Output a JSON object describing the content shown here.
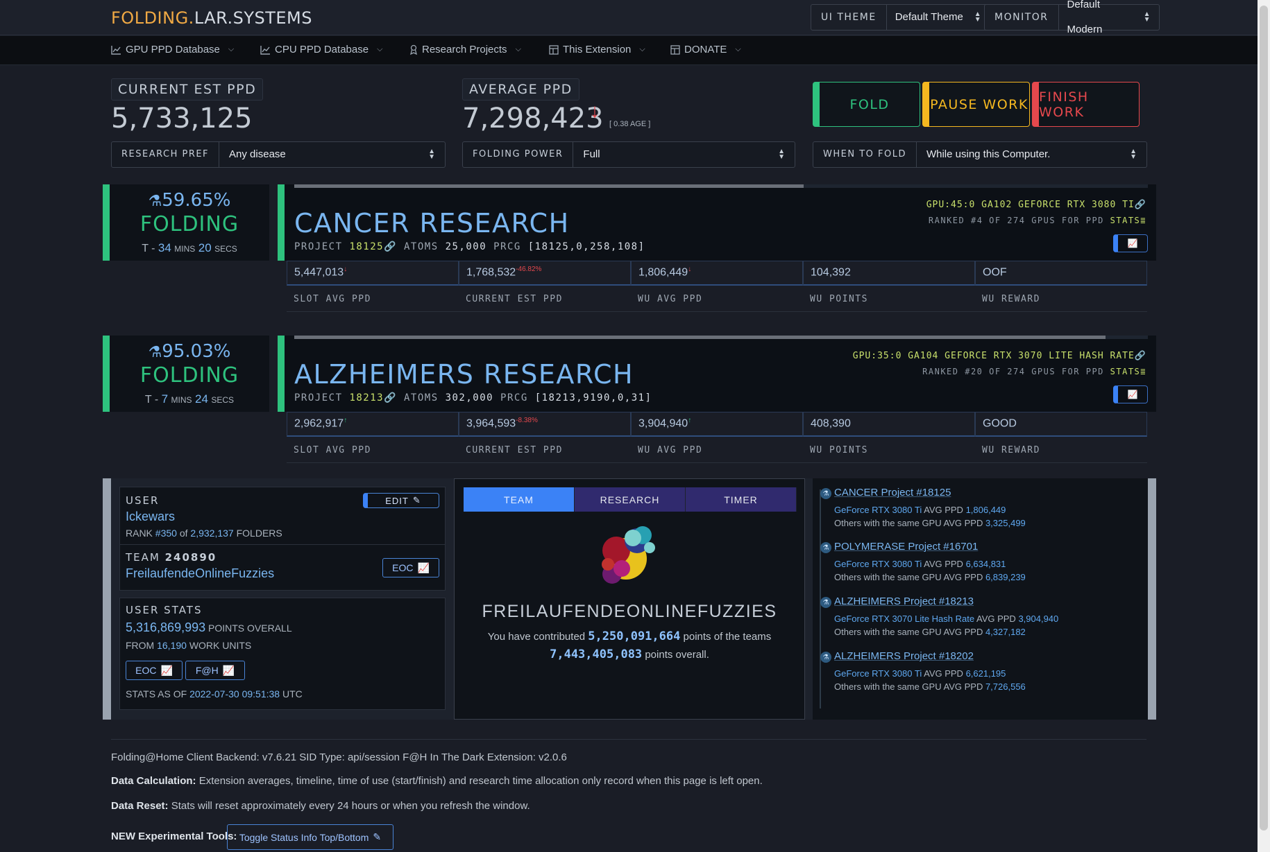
{
  "header": {
    "logo_part1": "FOLDING.",
    "logo_part2": "LAR.SYSTEMS",
    "ui_theme_label": "UI THEME",
    "ui_theme_value": "Default Theme",
    "monitor_label": "MONITOR",
    "monitor_value": "Default Modern"
  },
  "nav": {
    "items": [
      {
        "label": "GPU PPD Database",
        "icon": "chart-line-icon"
      },
      {
        "label": "CPU PPD Database",
        "icon": "chart-line-icon"
      },
      {
        "label": "Research Projects",
        "icon": "ribbon-icon"
      },
      {
        "label": "This Extension",
        "icon": "window-icon"
      },
      {
        "label": "DONATE",
        "icon": "window-icon"
      }
    ]
  },
  "stats": {
    "current_label": "CURRENT EST PPD",
    "current_value": "5,733,125",
    "average_label": "AVERAGE PPD",
    "average_value": "7,298,423",
    "average_age": "[ 0.38 AGE ]",
    "average_trend": "down"
  },
  "controls": {
    "fold": "FOLD",
    "pause": "PAUSE WORK",
    "finish": "FINISH WORK",
    "research_pref_label": "RESEARCH PREF",
    "research_pref_value": "Any disease",
    "folding_power_label": "FOLDING POWER",
    "folding_power_value": "Full",
    "when_label": "WHEN TO FOLD",
    "when_value": "While using this Computer."
  },
  "work_units": [
    {
      "percent": "59.65%",
      "progress": 0.5965,
      "state": "FOLDING",
      "eta_prefix": "T - ",
      "eta_mins": "34",
      "eta_mins_unit": "MINS",
      "eta_secs": "20",
      "eta_secs_unit": "SECS",
      "title": "CANCER RESEARCH",
      "project_label": "PROJECT",
      "project": "18125",
      "atoms_label": "ATOMS",
      "atoms": "25,000",
      "prcg_label": "PRCG",
      "prcg": "[18125,0,258,108]",
      "gpu": "GPU:45:0 GA102 GEFORCE RTX 3080 TI",
      "rank": "RANKED #4 OF 274 GPUS FOR PPD",
      "stats_link": "STATS",
      "cells": [
        {
          "value": "5,447,013",
          "mark": "↓",
          "mark_class": "down"
        },
        {
          "value": "1,768,532",
          "mark": "-46.82%",
          "mark_class": "down"
        },
        {
          "value": "1,806,449",
          "mark": "↓",
          "mark_class": "down"
        },
        {
          "value": "104,392",
          "mark": "",
          "mark_class": ""
        },
        {
          "value": "OOF",
          "mark": "",
          "mark_class": ""
        }
      ],
      "labels": [
        "SLOT AVG PPD",
        "CURRENT EST PPD",
        "WU AVG PPD",
        "WU POINTS",
        "WU REWARD"
      ]
    },
    {
      "percent": "95.03%",
      "progress": 0.9503,
      "state": "FOLDING",
      "eta_prefix": "T - ",
      "eta_mins": "7",
      "eta_mins_unit": "MINS",
      "eta_secs": "24",
      "eta_secs_unit": "SECS",
      "title": "ALZHEIMERS RESEARCH",
      "project_label": "PROJECT",
      "project": "18213",
      "atoms_label": "ATOMS",
      "atoms": "302,000",
      "prcg_label": "PRCG",
      "prcg": "[18213,9190,0,31]",
      "gpu": "GPU:35:0 GA104 GEFORCE RTX 3070 LITE HASH RATE",
      "rank": "RANKED #20 OF 274 GPUS FOR PPD",
      "stats_link": "STATS",
      "cells": [
        {
          "value": "2,962,917",
          "mark": "↑",
          "mark_class": "up"
        },
        {
          "value": "3,964,593",
          "mark": "-8.38%",
          "mark_class": "down"
        },
        {
          "value": "3,904,940",
          "mark": "↑",
          "mark_class": "up"
        },
        {
          "value": "408,390",
          "mark": "",
          "mark_class": ""
        },
        {
          "value": "GOOD",
          "mark": "",
          "mark_class": ""
        }
      ],
      "labels": [
        "SLOT AVG PPD",
        "CURRENT EST PPD",
        "WU AVG PPD",
        "WU POINTS",
        "WU REWARD"
      ]
    }
  ],
  "user": {
    "label": "USER",
    "name": "Ickewars",
    "edit": "EDIT",
    "rank_prefix": "RANK ",
    "rank": "#350",
    "rank_of": " of ",
    "rank_total": "2,932,137",
    "rank_suffix": " FOLDERS",
    "team_label": "TEAM",
    "team_id": "240890",
    "team_name": "FreilaufendeOnlineFuzzies",
    "eoc": "EOC"
  },
  "user_stats": {
    "label": "USER STATS",
    "points": "5,316,869,993",
    "points_suffix": " POINTS OVERALL",
    "from_prefix": "FROM ",
    "units": "16,190",
    "units_suffix": " WORK UNITS",
    "eoc": "EOC",
    "fah": "F@H",
    "as_of_prefix": "STATS AS OF ",
    "as_of": "2022-07-30 09:51:38",
    "as_of_suffix": " UTC"
  },
  "team_tab": {
    "tabs": [
      "TEAM",
      "RESEARCH",
      "TIMER"
    ],
    "team_title": "FREILAUFENDEONLINEFUZZIES",
    "contrib_prefix": "You have contributed ",
    "contrib_points": "5,250,091,664",
    "contrib_mid": " points of the teams",
    "team_points": "7,443,405,083",
    "team_suffix": " points overall."
  },
  "timeline": [
    {
      "title": "CANCER Project #18125",
      "gpu": "GeForce RTX 3080 Ti",
      "avg": "1,806,449",
      "others": "3,325,499"
    },
    {
      "title": "POLYMERASE Project #16701",
      "gpu": "GeForce RTX 3080 Ti",
      "avg": "6,634,831",
      "others": "6,839,239"
    },
    {
      "title": "ALZHEIMERS Project #18213",
      "gpu": "GeForce RTX 3070 Lite Hash Rate",
      "avg": "3,904,940",
      "others": "4,327,182"
    },
    {
      "title": "ALZHEIMERS Project #18202",
      "gpu": "GeForce RTX 3080 Ti",
      "avg": "6,621,195",
      "others": "7,726,556"
    }
  ],
  "timeline_text": {
    "avg_label": " AVG PPD ",
    "others_label": "Others with the same GPU AVG PPD "
  },
  "footer": {
    "backend": "Folding@Home Client Backend: v7.6.21   SID Type: api/session   F@H In The Dark Extension: v2.0.6",
    "calc_label": "Data Calculation:",
    "calc_text": " Extension averages, timeline, time of use (start/finish) and research time allocation only record when this page is left open.",
    "reset_label": "Data Reset:",
    "reset_text": " Stats will reset approximately every 24 hours or when you refresh the window.",
    "tools_label": "NEW Experimental Tools:",
    "toggle_btn": "Toggle Status Info Top/Bottom"
  },
  "colors": {
    "accent_green": "#2ec27e",
    "accent_blue": "#7ab6f0",
    "pause_yellow": "#f5b820",
    "finish_red": "#e5484d",
    "gpu_green": "#c8e06b"
  }
}
